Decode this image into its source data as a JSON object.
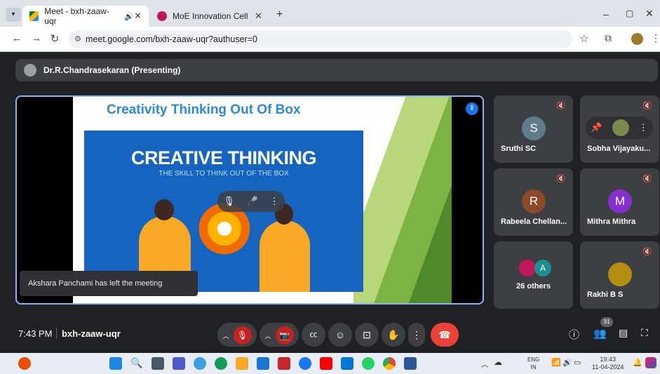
{
  "browser": {
    "tabs": [
      {
        "title": "Meet - bxh-zaaw-uqr",
        "active": true
      },
      {
        "title": "MoE Innovation Cell",
        "active": false
      }
    ],
    "new_tab": "+",
    "url": "meet.google.com/bxh-zaaw-uqr?authuser=0",
    "window_controls": [
      "–",
      "▢",
      "✕"
    ]
  },
  "presenter": {
    "label": "Dr.R.Chandrasekaran (Presenting)"
  },
  "slide": {
    "title": "Creativity Thinking Out Of Box",
    "heading": "CREATIVE THINKING",
    "subheading": "THE SKILL TO THINK OUT OF THE BOX"
  },
  "toast": "Akshara Panchami has left the meeting",
  "participants": [
    {
      "name": "Sruthi SC",
      "initial": "S",
      "color": "#5f7c8a"
    },
    {
      "name": "Sobha Vijayaku...",
      "initial": "",
      "color": "#7b8a4a"
    },
    {
      "name": "Rabeela Chellan...",
      "initial": "R",
      "color": "#8d4a2a"
    },
    {
      "name": "Mithra Mithra",
      "initial": "M",
      "color": "#8430ce"
    },
    {
      "name": "26 others",
      "initial": "A",
      "color": "#1e8e8e"
    },
    {
      "name": "Rakhi B S",
      "initial": "",
      "color": "#b58f12"
    }
  ],
  "meeting": {
    "time": "7:43 PM",
    "code": "bxh-zaaw-uqr",
    "participant_count": "31"
  },
  "taskbar": {
    "lang": "ENG",
    "region": "IN",
    "time": "19:43",
    "date": "11-04-2024"
  }
}
